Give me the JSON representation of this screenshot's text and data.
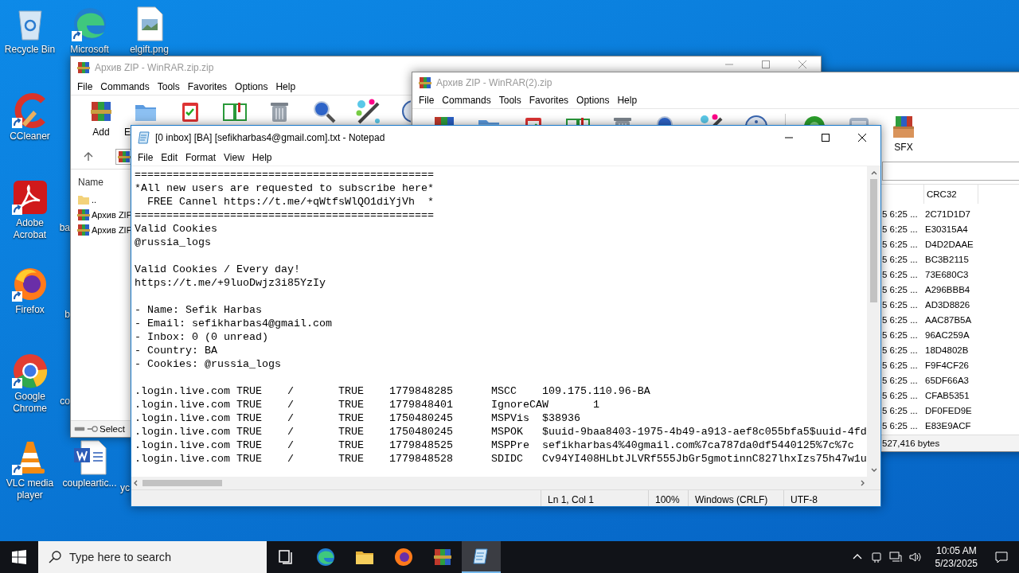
{
  "desktop": {
    "columns": [
      [
        {
          "kind": "recycle",
          "label": "Recycle Bin"
        },
        {
          "kind": "ccleaner",
          "label": "CCleaner"
        },
        {
          "kind": "acrobat",
          "label": "Adobe Acrobat"
        },
        {
          "kind": "firefox",
          "label": "Firefox"
        },
        {
          "kind": "chrome",
          "label": "Google Chrome"
        },
        {
          "kind": "vlc",
          "label": "VLC media player"
        }
      ],
      [
        {
          "kind": "edge",
          "label": "Microsoft"
        },
        {
          "kind": "covered"
        },
        {
          "kind": "partial",
          "label": "ba"
        },
        {
          "kind": "partial",
          "label": "b"
        },
        {
          "kind": "partial",
          "label": "co"
        },
        {
          "kind": "word",
          "label": "coupleartic..."
        }
      ],
      [
        {
          "kind": "image",
          "label": "elgift.png"
        },
        {
          "kind": "covered"
        },
        {
          "kind": "covered"
        },
        {
          "kind": "covered"
        },
        {
          "kind": "covered"
        },
        {
          "kind": "partial",
          "label": "yc"
        }
      ]
    ]
  },
  "archive_window": {
    "title": "Архив ZIP - WinRAR.zip.zip",
    "menu": [
      "File",
      "Commands",
      "Tools",
      "Favorites",
      "Options",
      "Help"
    ],
    "toolbar": [
      {
        "kind": "archive",
        "label": "Add"
      },
      {
        "kind": "folder",
        "label": "E"
      },
      {
        "kind": "clipboard"
      },
      {
        "kind": "book"
      },
      {
        "kind": "trash"
      },
      {
        "kind": "magnifier"
      },
      {
        "kind": "wand"
      },
      {
        "kind": "info"
      }
    ],
    "file_list": {
      "columns": [
        "Name"
      ],
      "rows": [
        {
          "kind": "folder",
          "name": ".."
        },
        {
          "kind": "archive",
          "name": "Архив ZIP"
        },
        {
          "kind": "archive",
          "name": "Архив ZIP"
        }
      ]
    },
    "status": "Select"
  },
  "archive_window_2": {
    "title": "Архив ZIP - WinRAR(2).zip",
    "menu": [
      "File",
      "Commands",
      "Tools",
      "Favorites",
      "Options",
      "Help"
    ],
    "toolbar": [
      {
        "kind": "archive"
      },
      {
        "kind": "folder"
      },
      {
        "kind": "clipboard"
      },
      {
        "kind": "book"
      },
      {
        "kind": "trash"
      },
      {
        "kind": "magnifier"
      },
      {
        "kind": "wand"
      },
      {
        "kind": "info"
      },
      {
        "kind": "scan"
      },
      {
        "kind": "comment"
      },
      {
        "kind": "sfx",
        "label": "SFX"
      }
    ],
    "file_list": {
      "columns": [
        "CRC32"
      ],
      "rows": [
        {
          "column_1": "5 6:25 ...",
          "crc32": "2C71D1D7"
        },
        {
          "column_1": "5 6:25 ...",
          "crc32": "E30315A4"
        },
        {
          "column_1": "5 6:25 ...",
          "crc32": "D4D2DAAE"
        },
        {
          "column_1": "5 6:25 ...",
          "crc32": "BC3B2115"
        },
        {
          "column_1": "5 6:25 ...",
          "crc32": "73E680C3"
        },
        {
          "column_1": "5 6:25 ...",
          "crc32": "A296BBB4"
        },
        {
          "column_1": "5 6:25 ...",
          "crc32": "AD3D8826"
        },
        {
          "column_1": "5 6:25 ...",
          "crc32": "AAC87B5A"
        },
        {
          "column_1": "5 6:25 ...",
          "crc32": "96AC259A"
        },
        {
          "column_1": "5 6:25 ...",
          "crc32": "18D4802B"
        },
        {
          "column_1": "5 6:25 ...",
          "crc32": "F9F4CF26"
        },
        {
          "column_1": "5 6:25 ...",
          "crc32": "65DF66A3"
        },
        {
          "column_1": "5 6:25 ...",
          "crc32": "CFAB5351"
        },
        {
          "column_1": "5 6:25 ...",
          "crc32": "DF0FED9E"
        },
        {
          "column_1": "5 6:25 ...",
          "crc32": "E83E9ACF"
        }
      ]
    },
    "status": "527,416 bytes"
  },
  "notepad": {
    "title": "[0 inbox] [BA] [sefikharbas4@gmail.com].txt - Notepad",
    "menu": [
      "File",
      "Edit",
      "Format",
      "View",
      "Help"
    ],
    "paragraphs": [
      [
        "===============================================",
        "*All new users are requested to subscribe here*",
        "  FREE Cannel https://t.me/+qWtfsWlQO1diYjVh  *",
        "===============================================",
        "Valid Cookies",
        "@russia_logs"
      ],
      [
        "Valid Cookies / Every day!",
        "https://t.me/+9luoDwjz3i85YzIy"
      ],
      [
        "- Name: Sefik Harbas",
        "- Email: sefikharbas4@gmail.com",
        "- Inbox: 0 (0 unread)",
        "- Country: BA",
        "- Cookies: @russia_logs"
      ],
      [
        ".login.live.com\tTRUE\t/\tTRUE\t1779848285\tMSCC\t109.175.110.96-BA",
        ".login.live.com\tTRUE\t/\tTRUE\t1779848401\tIgnoreCAW\t1",
        ".login.live.com\tTRUE\t/\tTRUE\t1750480245\tMSPVis\t$38936",
        ".login.live.com\tTRUE\t/\tTRUE\t1750480245\tMSPOK\t$uuid-9baa8403-1975-4b49-a913-aef8c055bfa5$uuid-4fd",
        ".login.live.com\tTRUE\t/\tTRUE\t1779848525\tMSPPre\tsefikharbas4%40gmail.com%7ca787da0df5440125%7c%7c",
        ".login.live.com\tTRUE\t/\tTRUE\t1779848528\tSDIDC\tCv94YI408HLbtJLVRf555JbGr5gmotinnC827lhxIzs75h47w1u"
      ]
    ],
    "status_bar": [
      "Ln 1, Col 1",
      "100%",
      "Windows (CRLF)",
      "UTF-8"
    ]
  },
  "taskbar": {
    "search": {
      "placeholder": "Type here to search"
    },
    "apps": [
      {
        "kind": "taskview",
        "active": false
      },
      {
        "kind": "edge",
        "active": false
      },
      {
        "kind": "explorer",
        "active": false
      },
      {
        "kind": "firefox",
        "active": false
      },
      {
        "kind": "winrar",
        "active": false
      },
      {
        "kind": "notepad",
        "active": true
      }
    ],
    "clock": {
      "time": "10:05 AM",
      "date": "5/23/2025"
    }
  }
}
